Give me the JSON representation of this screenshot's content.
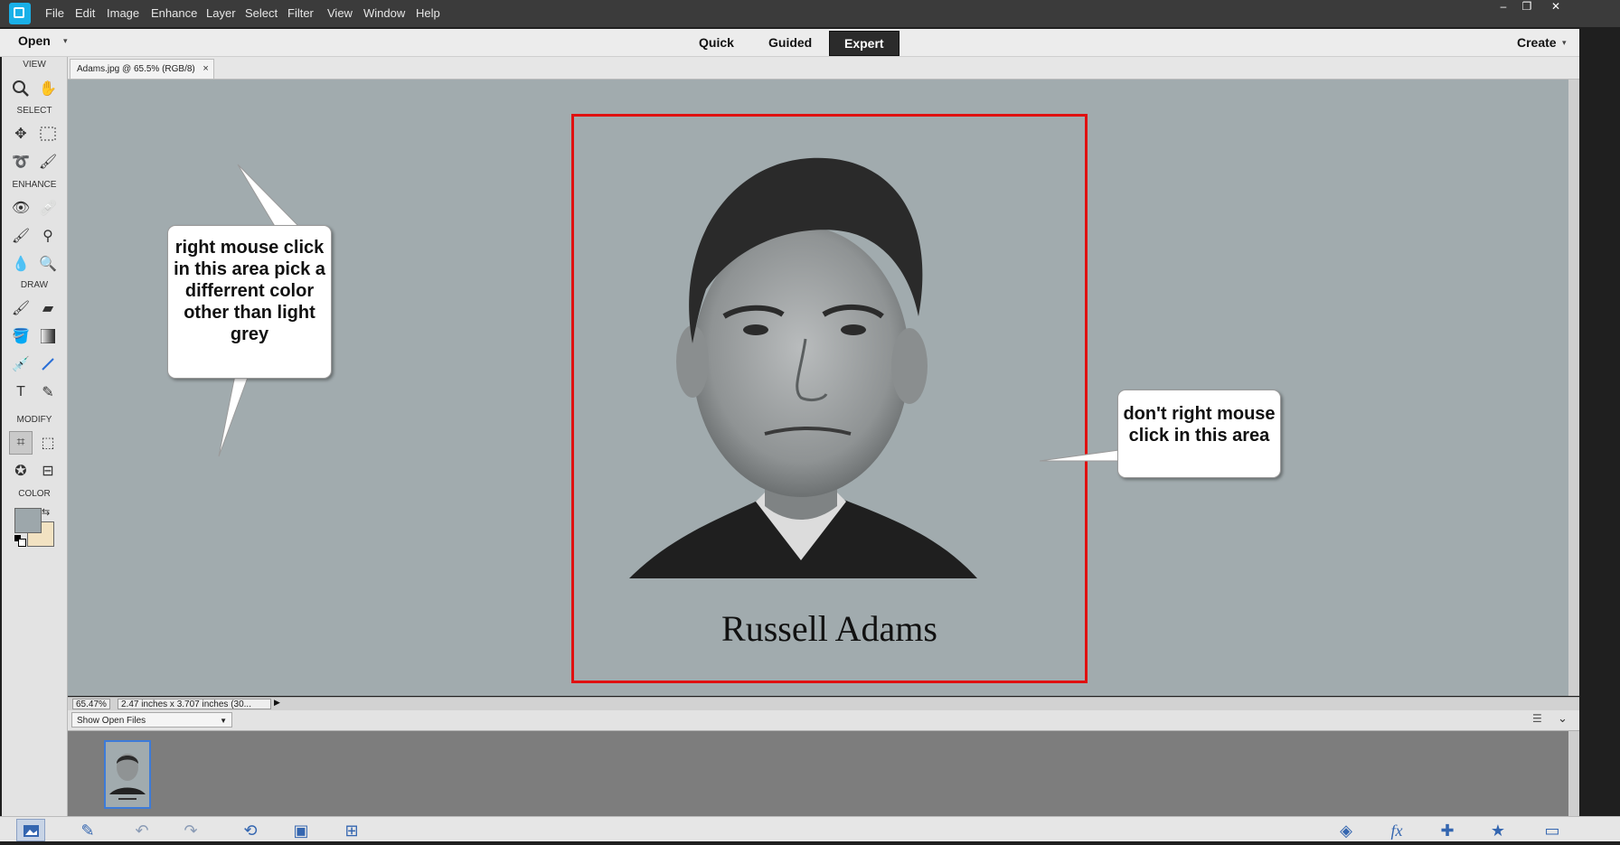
{
  "menubar": {
    "items": [
      "File",
      "Edit",
      "Image",
      "Enhance",
      "Layer",
      "Select",
      "Filter",
      "View",
      "Window",
      "Help"
    ],
    "window_controls": [
      "–",
      "❐",
      "✕"
    ]
  },
  "modebar": {
    "open_label": "Open",
    "tabs": [
      "Quick",
      "Guided",
      "Expert"
    ],
    "active_tab": "Expert",
    "create_label": "Create"
  },
  "toolbox": {
    "sections": {
      "view": "VIEW",
      "select": "SELECT",
      "enhance": "ENHANCE",
      "draw": "DRAW",
      "modify": "MODIFY",
      "color": "COLOR"
    },
    "foreground_color": "#9da7ab",
    "background_color": "#f2e2c2"
  },
  "document": {
    "tab_label": "Adams.jpg @ 65.5% (RGB/8)",
    "close_glyph": "×",
    "caption": "Russell Adams"
  },
  "callouts": {
    "left": "right mouse click in this area pick a differrent color other than light grey",
    "right": "don't right mouse click in this area"
  },
  "statusbar": {
    "zoom": "65.47%",
    "doc_info": "2.47 inches x 3.707 inches (30..."
  },
  "photo_bin": {
    "filter_label": "Show Open Files"
  },
  "colors": {
    "canvas": "#a1abae",
    "frame": "#e01010",
    "accent": "#19b0e8"
  }
}
